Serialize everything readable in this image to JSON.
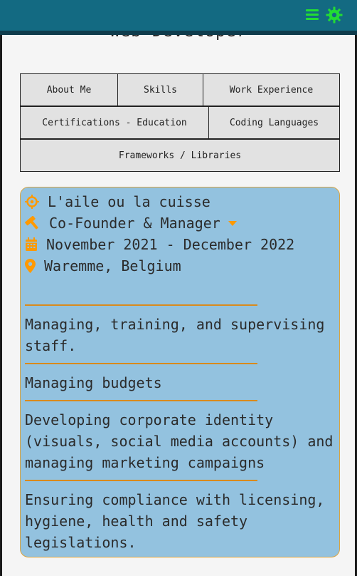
{
  "header": {
    "page_title": "Web Developer",
    "menu_icon": "hamburger-menu-icon",
    "settings_icon": "gear-icon",
    "accent_color": "#22dd33",
    "bar_color": "#136a82"
  },
  "tabs": [
    {
      "label": "About Me"
    },
    {
      "label": "Skills"
    },
    {
      "label": "Work Experience"
    },
    {
      "label": "Certifications - Education"
    },
    {
      "label": "Coding Languages"
    },
    {
      "label": "Frameworks / Libraries"
    }
  ],
  "job": {
    "company": "L'aile ou la cuisse",
    "role": "Co-Founder & Manager",
    "dates": "November 2021 - December 2022",
    "location": "Waremme, Belgium",
    "icons": [
      "crosshair-icon",
      "hammer-icon",
      "calendar-icon",
      "map-pin-icon",
      "caret-down-icon"
    ],
    "icon_color": "#ff9900",
    "card_color": "#93c2df",
    "duties": [
      "Managing, training, and supervising staff.",
      "Managing budgets",
      "Developing corporate identity (visuals, social media accounts) and managing marketing campaigns",
      "Ensuring compliance with licensing, hygiene, health and safety legislations."
    ]
  }
}
